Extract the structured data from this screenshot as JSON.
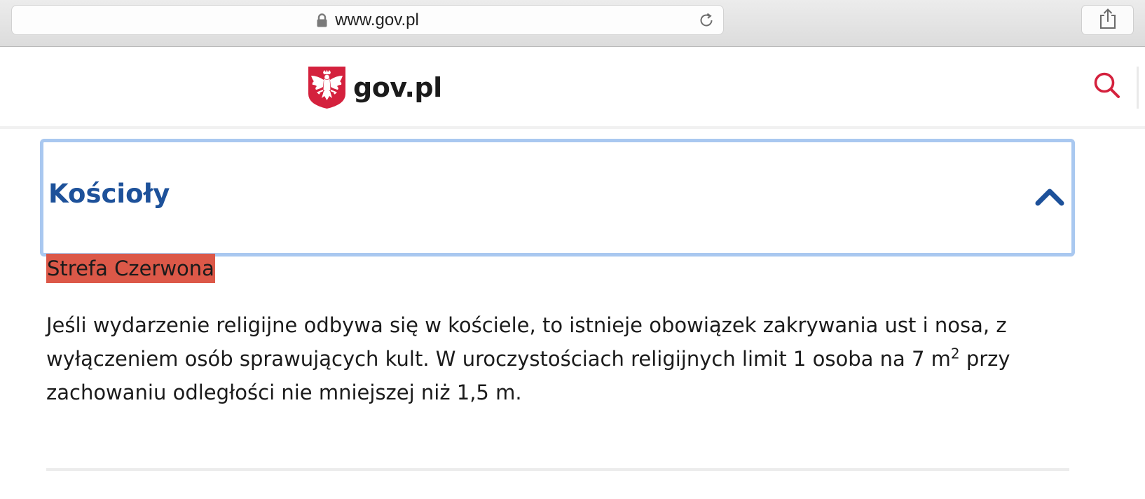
{
  "browser": {
    "url": "www.gov.pl"
  },
  "header": {
    "logo_text": "gov.pl"
  },
  "accordion": {
    "title": "Kościoły",
    "expanded": true
  },
  "content": {
    "zone_label": "Strefa Czerwona",
    "paragraph_part1": "Jeśli wydarzenie religijne odbywa się w kościele, to istnieje obowiązek zakrywania ust i nosa, z wyłączeniem osób sprawujących kult. W uroczystościach religijnych limit 1 osoba na 7 m",
    "paragraph_sup": "2",
    "paragraph_part2": " przy zachowaniu odległości nie mniejszej niż 1,5 m."
  },
  "colors": {
    "accent_blue": "#1d519a",
    "focus_outline": "#a9c8f0",
    "red_zone": "#dc5848",
    "emblem_red": "#d4213d",
    "search_red": "#d4213d"
  },
  "icons": {
    "lock": "lock-icon",
    "reload": "reload-icon",
    "share": "share-icon",
    "emblem": "polish-eagle-emblem-icon",
    "search": "search-icon",
    "chevron": "chevron-up-icon"
  }
}
